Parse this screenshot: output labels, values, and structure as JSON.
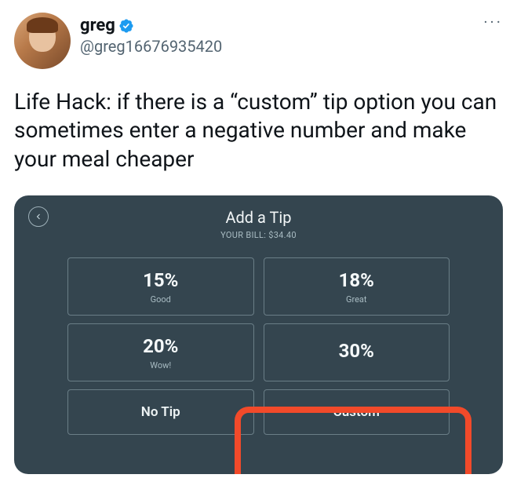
{
  "tweet": {
    "display_name": "greg",
    "handle": "@greg16676935420",
    "more": "···",
    "text": "Life Hack: if there is a “custom” tip option you can sometimes enter a negative number and make your meal cheaper"
  },
  "tip_screen": {
    "title": "Add a Tip",
    "subtitle": "YOUR BILL: $34.40",
    "options": [
      {
        "pct": "15%",
        "label": "Good"
      },
      {
        "pct": "18%",
        "label": "Great"
      },
      {
        "pct": "20%",
        "label": "Wow!"
      },
      {
        "pct": "30%",
        "label": ""
      },
      {
        "single": "No Tip"
      },
      {
        "single": "Custom"
      }
    ]
  }
}
